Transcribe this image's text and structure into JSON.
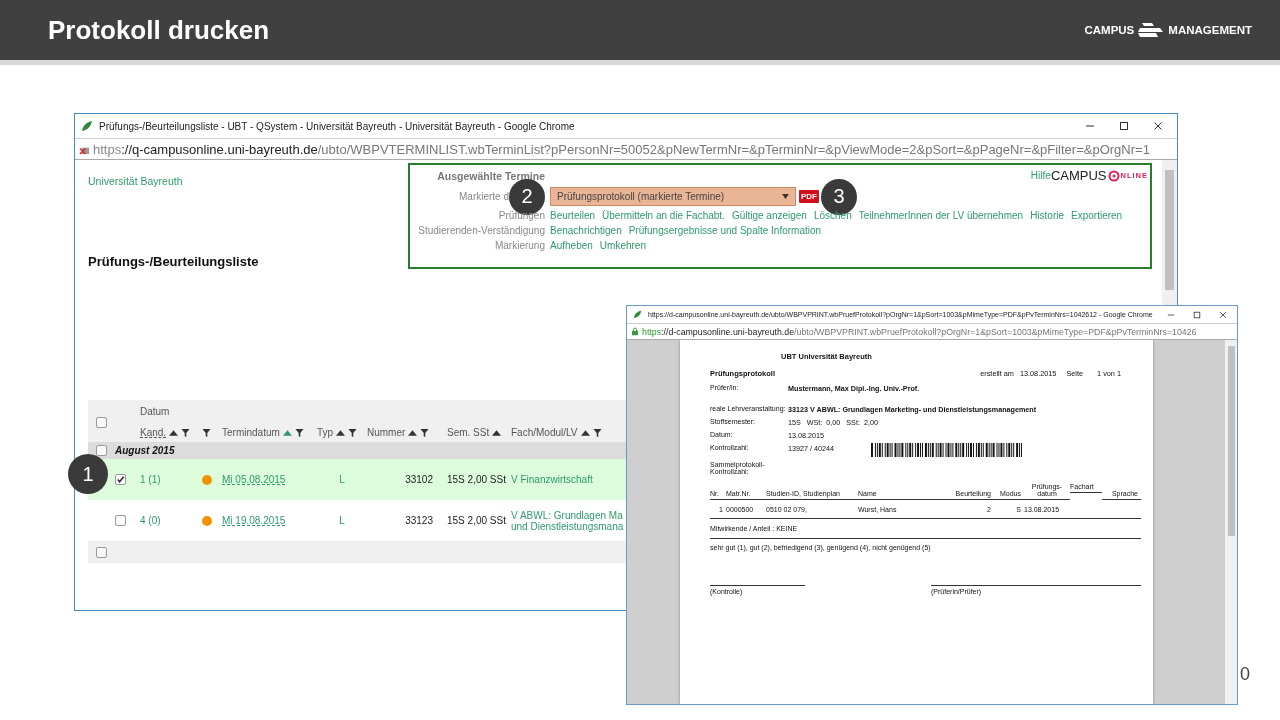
{
  "slide": {
    "title": "Protokoll drucken",
    "logo_left": "CAMPUS",
    "logo_right": "MANAGEMENT",
    "page_number": "0"
  },
  "callouts": [
    "1",
    "2",
    "3"
  ],
  "list_window": {
    "title": "Prüfungs-/Beurteilungsliste - UBT - QSystem - Universität Bayreuth - Universität Bayreuth - Google Chrome",
    "secure": false,
    "url_scheme": "https",
    "url_host": "://q-campusonline.uni-bayreuth.de",
    "url_path": "/ubto/WBPVTERMINLIST.wbTerminList?pPersonNr=50052&pNewTermNr=&pTerminNr=&pViewMode=2&pSort=&pPageNr=&pFilter=&pOrgNr=1",
    "home_link": "Universität Bayreuth",
    "heading": "Prüfungs-/Beurteilungsliste",
    "actions": {
      "title": "Ausgewählte Termine",
      "help": "Hilfe",
      "logo": "CAMPUS",
      "logo_suffix": "NLINE",
      "rows": [
        {
          "kind": "select",
          "label": "Markierte d",
          "value": "Prüfungsprotokoll (markierte Termine)",
          "format": "PDF"
        },
        {
          "kind": "links",
          "label": "Prüfungen",
          "links": [
            "Beurteilen",
            "Übermitteln an die Fachabt.",
            "Gültige anzeigen",
            "Löschen",
            "TeilnehmerInnen der LV übernehmen",
            "Historie",
            "Exportieren"
          ]
        },
        {
          "kind": "links",
          "label": "Studierenden-Verständigung",
          "links": [
            "Benachrichtigen",
            "Prüfungsergebnisse und Spalte Information"
          ]
        },
        {
          "kind": "links",
          "label": "Markierung",
          "links": [
            "Aufheben",
            "Umkehren"
          ]
        }
      ]
    },
    "table": {
      "select_all": {
        "checked": false
      },
      "header_top": "Datum",
      "columns": [
        {
          "label": "Kand.",
          "sortable": true,
          "filterable": true,
          "sorted": false
        },
        {
          "sortable": false,
          "filterable": true
        },
        {
          "label": "Termindatum",
          "sortable": true,
          "filterable": true,
          "sorted": true
        },
        {
          "label": "Typ",
          "sortable": true,
          "filterable": true,
          "sorted": false
        },
        {
          "label": "Nummer",
          "sortable": true,
          "filterable": true,
          "sorted": false
        },
        {
          "label": "Sem. SSt",
          "sortable": true,
          "filterable": false,
          "sorted": false
        },
        {
          "label": "Fach/Modul/LV",
          "sortable": true,
          "filterable": true,
          "sorted": false
        }
      ],
      "group": {
        "label": "August 2015",
        "checked": false
      },
      "rows": [
        {
          "checked": true,
          "kand": "1 (1)",
          "color": "#f39200",
          "date": "Mi 05.08.2015",
          "typ": "L",
          "nummer": "33102",
          "sst": "15S 2,00 SSt",
          "fach": [
            "V Finanzwirtschaft"
          ]
        },
        {
          "checked": false,
          "kand": "4 (0)",
          "color": "#f39200",
          "date": "Mi 19.08.2015",
          "typ": "L",
          "nummer": "33123",
          "sst": "15S 2,00 SSt",
          "fach": [
            "V ABWL: Grundlagen Ma",
            "und Dienstleistungsmana"
          ]
        }
      ],
      "footer": {
        "checked": false
      }
    }
  },
  "print_window": {
    "title": "https://d-campusonline.uni-bayreuth.de/ubto/WBPVPRINT.wbPruefProtokoll?pOrgNr=1&pSort=1003&pMimeType=PDF&pPvTerminNrs=1042612 - Google Chrome",
    "secure": true,
    "url_scheme": "https",
    "url_host": "://d-campusonline.uni-bayreuth.de",
    "url_path": "/ubto/WBPVPRINT.wbPruefProtokoll?pOrgNr=1&pSort=1003&pMimeType=PDF&pPvTerminNrs=10426",
    "document": {
      "institution": "UBT Universität Bayreuth",
      "doc_title": "Prüfungsprotokoll",
      "created_label": "erstellt am",
      "created_date": "13.08.2015",
      "page_label": "Seite",
      "page_value": "1 von 1",
      "fields": [
        {
          "label": "Prüfer/in:",
          "value": "Mustermann, Max Dipl.-Ing. Univ.-Prof.",
          "bold": true,
          "barcode": false
        },
        {
          "label": "reale Lehrveranstaltung:",
          "value": "33123 V ABWL: Grundlagen Marketing- und Dienstleistungsmanagement",
          "bold": true,
          "barcode": false
        },
        {
          "label": "Stoffsemester:",
          "value": "15S   WSt:  0,00   SSt:  2,00",
          "bold": false,
          "barcode": false
        },
        {
          "label": "Datum:",
          "value": "13.08.2015",
          "bold": false,
          "barcode": false
        },
        {
          "label": "Kontrollzahl:",
          "value": "13927 / 40244",
          "bold": false,
          "barcode": true
        },
        {
          "label": "Sammelprotokoll-Kontrollzahl:",
          "barcode": false
        }
      ],
      "columns": [
        "Nr.",
        "Matr.Nr.",
        "Studien-ID, Studienplan",
        "Name",
        "Beurteilung",
        "Modus",
        "Prüfungs- datum",
        "Fachart",
        "Sprache"
      ],
      "rows": [
        [
          "1",
          "0000500",
          "0510 02 079,",
          "Wurst, Hans",
          "2",
          "S",
          "13.08.2015"
        ]
      ],
      "contributors": "Mitwirkende / Anteil :  KEINE",
      "grade_legend": "sehr gut (1), gut (2), befriedigend (3), genügend (4), nicht genügend (5)",
      "signatures": [
        "(Kontrolle)",
        "(Prüferin/Prüfer)"
      ]
    }
  }
}
